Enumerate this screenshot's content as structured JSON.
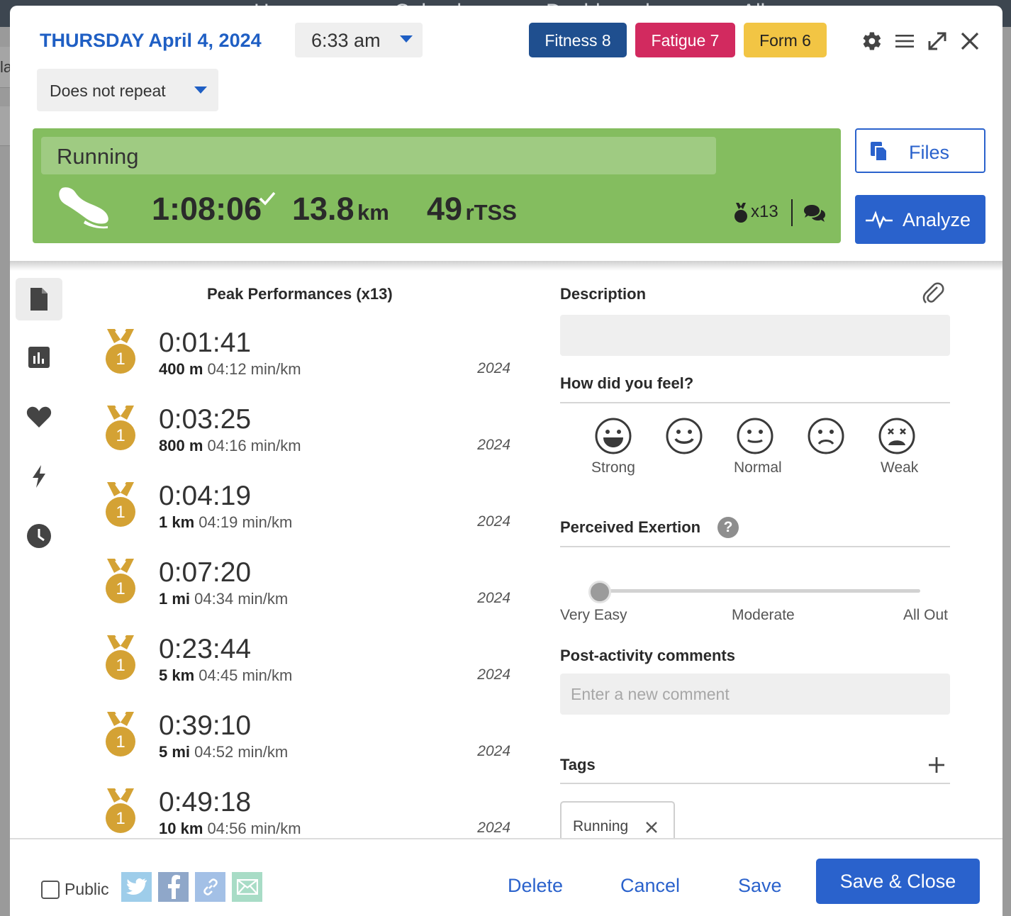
{
  "background": {
    "nav": [
      "Home",
      "Calendar",
      "Dashboard",
      "All"
    ],
    "left_letters": "la"
  },
  "header": {
    "date": "THURSDAY April 4, 2024",
    "time": "6:33 am",
    "repeat": "Does not repeat",
    "fitness": "Fitness 8",
    "fatigue": "Fatigue 7",
    "form": "Form 6"
  },
  "activity": {
    "title": "Running",
    "duration": "1:08:06",
    "distance_value": "13.8",
    "distance_unit": "km",
    "load_value": "49",
    "load_unit": "rTSS",
    "medal_count": "x13",
    "color": "#84bd5f"
  },
  "buttons": {
    "files": "Files",
    "analyze": "Analyze"
  },
  "peak_performances": {
    "title": "Peak Performances (x13)",
    "rows": [
      {
        "rank": "1",
        "time": "0:01:41",
        "distance": "400 m",
        "pace": "04:12 min/km",
        "year": "2024"
      },
      {
        "rank": "1",
        "time": "0:03:25",
        "distance": "800 m",
        "pace": "04:16 min/km",
        "year": "2024"
      },
      {
        "rank": "1",
        "time": "0:04:19",
        "distance": "1 km",
        "pace": "04:19 min/km",
        "year": "2024"
      },
      {
        "rank": "1",
        "time": "0:07:20",
        "distance": "1 mi",
        "pace": "04:34 min/km",
        "year": "2024"
      },
      {
        "rank": "1",
        "time": "0:23:44",
        "distance": "5 km",
        "pace": "04:45 min/km",
        "year": "2024"
      },
      {
        "rank": "1",
        "time": "0:39:10",
        "distance": "5 mi",
        "pace": "04:52 min/km",
        "year": "2024"
      },
      {
        "rank": "1",
        "time": "0:49:18",
        "distance": "10 km",
        "pace": "04:56 min/km",
        "year": "2024"
      }
    ]
  },
  "details": {
    "description_label": "Description",
    "description_value": "",
    "feel_label": "How did you feel?",
    "feel_options": [
      "Strong",
      "Normal",
      "Weak"
    ],
    "exertion_label": "Perceived Exertion",
    "exertion_help": "?",
    "exertion_value": 0,
    "exertion_scale": [
      "Very Easy",
      "Moderate",
      "All Out"
    ],
    "comments_label": "Post-activity comments",
    "comments_placeholder": "Enter a new comment",
    "tags_label": "Tags",
    "tags": [
      "Running"
    ]
  },
  "footer": {
    "public": "Public",
    "delete": "Delete",
    "cancel": "Cancel",
    "save": "Save",
    "save_close": "Save & Close"
  },
  "icons": {
    "settings": "gear-icon",
    "menu": "hamburger-icon",
    "expand": "expand-icon",
    "close": "close-icon",
    "files": "files-icon",
    "analyze": "pulse-icon",
    "shoe": "running-shoe-icon",
    "medal": "medal-icon",
    "comments": "chat-icon",
    "attach": "paperclip-icon",
    "add": "plus-icon",
    "remove": "x-icon"
  },
  "colors": {
    "accent": "#2a62cc",
    "fitness": "#1f4f8f",
    "fatigue": "#d22a5f",
    "form": "#f2c544",
    "medal": "#d4a234"
  }
}
